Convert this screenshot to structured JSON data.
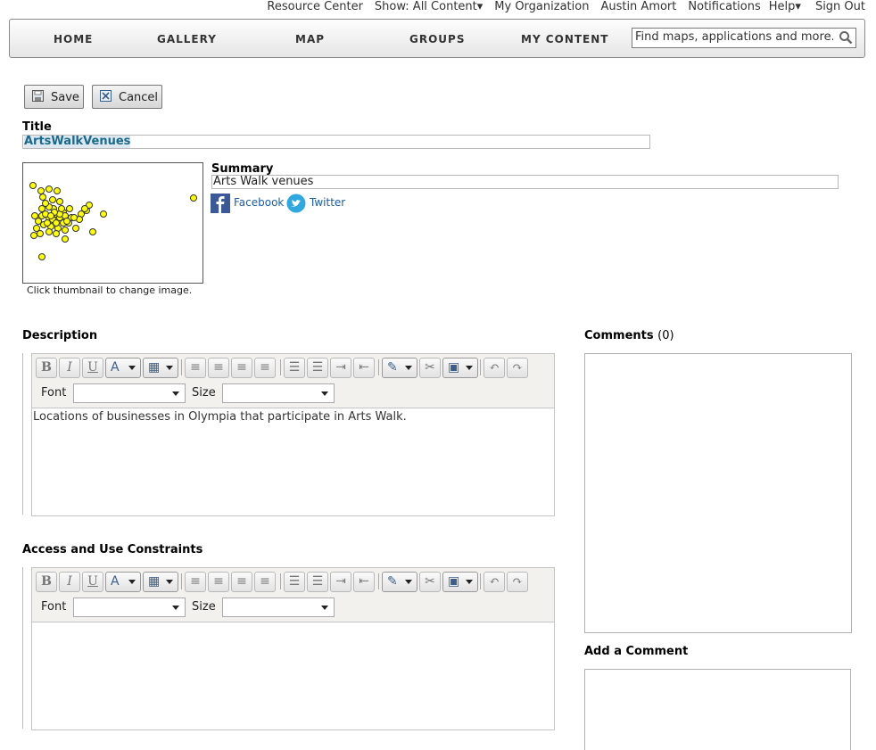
{
  "top_links": [
    "Resource Center",
    "Show: All Content▾",
    "My Organization",
    "Austin Amort",
    "Notifications",
    "Help▾",
    "Sign Out"
  ],
  "nav": {
    "home": "HOME",
    "gallery": "GALLERY",
    "map": "MAP",
    "groups": "GROUPS",
    "my_content": "MY CONTENT",
    "search_placeholder": "Find maps, applications and more..."
  },
  "actions": {
    "save": "Save",
    "cancel": "Cancel"
  },
  "item": {
    "title_label": "Title",
    "title_value": "ArtsWalkVenues",
    "thumb_caption": "Click thumbnail to change image.",
    "summary_label": "Summary",
    "summary_value": "Arts Walk venues",
    "facebook": "Facebook",
    "twitter": "Twitter"
  },
  "description": {
    "label": "Description",
    "font_label": "Font",
    "size_label": "Size",
    "text": "Locations of businesses in Olympia that participate in Arts Walk."
  },
  "constraints": {
    "label": "Access and Use Constraints",
    "font_label": "Font",
    "size_label": "Size",
    "text": ""
  },
  "comments": {
    "label": "Comments",
    "count": "(0)",
    "add_label": "Add a Comment"
  },
  "colors": {
    "point_fill": "#ffff00",
    "link": "#1a5ea7",
    "title_text": "#1a6a8a"
  },
  "icons": [
    "save-icon",
    "cancel-icon",
    "search-icon",
    "facebook-icon",
    "twitter-icon"
  ]
}
